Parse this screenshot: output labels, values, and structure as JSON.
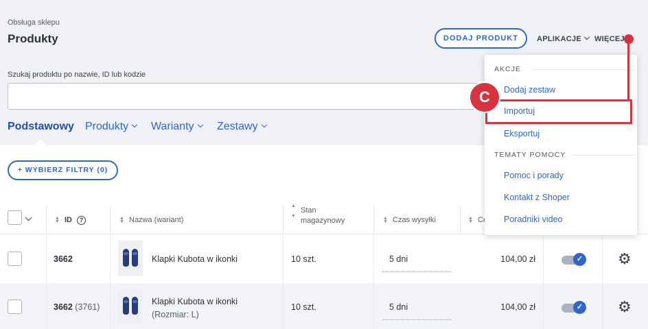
{
  "header": {
    "breadcrumb": "Obsługa sklepu",
    "title": "Produkty",
    "add_button": "DODAJ PRODUKT",
    "apps_label": "APLIKACJE",
    "more_label": "WIĘCEJ"
  },
  "search": {
    "label": "Szukaj produktu po nazwie, ID lub kodzie",
    "value": "",
    "placeholder": ""
  },
  "tabs": [
    {
      "label": "Podstawowy",
      "active": true
    },
    {
      "label": "Produkty",
      "active": false
    },
    {
      "label": "Warianty",
      "active": false
    },
    {
      "label": "Zestawy",
      "active": false
    }
  ],
  "filters": {
    "button": "+ WYBIERZ FILTRY (0)"
  },
  "table": {
    "columns": {
      "id": "ID",
      "name": "Nazwa (wariant)",
      "stock_line1": "Stan",
      "stock_line2": "magazynowy",
      "shipping": "Czas wysyłki",
      "price_partial": "Ce"
    },
    "rows": [
      {
        "id": "3662",
        "variant_id": "",
        "name": "Klapki Kubota w ikonki",
        "variant": "",
        "stock": "10 szt.",
        "shipping": "5 dni",
        "price": "104,00 zł",
        "active": true
      },
      {
        "id": "3662",
        "variant_id": "(3761)",
        "name": "Klapki Kubota w ikonki",
        "variant": "(Rozmiar: L)",
        "stock": "10 szt.",
        "shipping": "5 dni",
        "price": "104,00 zł",
        "active": true
      }
    ]
  },
  "dropdown": {
    "section_actions": "AKCJE",
    "actions": [
      "Dodaj zestaw",
      "Importuj",
      "Eksportuj"
    ],
    "section_help": "TEMATY POMOCY",
    "help": [
      "Pomoc i porady",
      "Kontakt z Shoper",
      "Poradniki video"
    ]
  },
  "annotation": {
    "badge": "C",
    "color": "#d7333f"
  },
  "icons": {
    "sort": "sort-arrows-icon",
    "help": "question-circle-icon",
    "gear": "gear-icon",
    "chevron": "chevron-down-icon",
    "check": "check-icon"
  },
  "colors": {
    "accent": "#2f66c8",
    "annotation": "#d7333f",
    "background": "#f0f1f5"
  }
}
